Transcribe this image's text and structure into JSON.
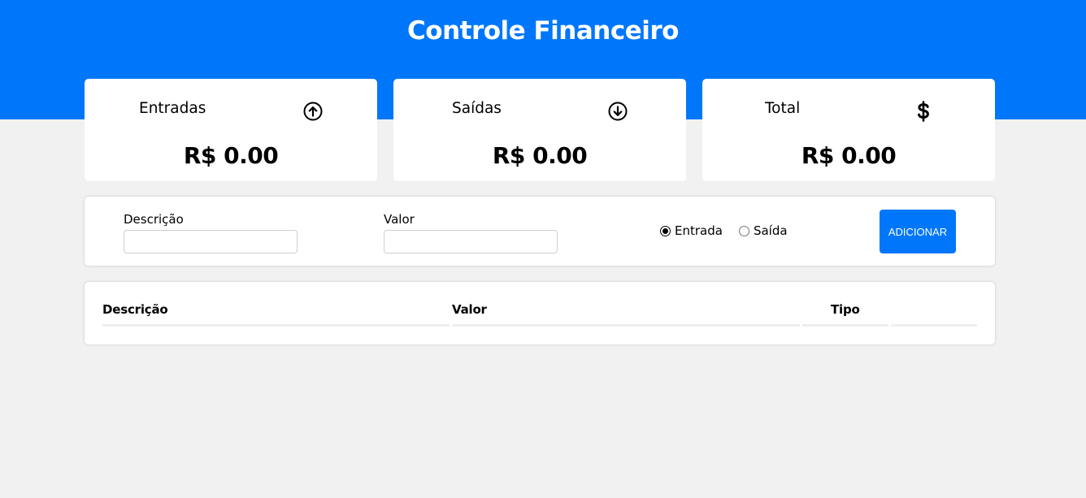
{
  "header": {
    "title": "Controle Financeiro",
    "background_color": "#0077fb"
  },
  "summary": {
    "income": {
      "label": "Entradas",
      "value": "R$ 0.00",
      "icon": "arrow-up-circle-icon"
    },
    "expense": {
      "label": "Saídas",
      "value": "R$ 0.00",
      "icon": "arrow-down-circle-icon"
    },
    "total": {
      "label": "Total",
      "value": "R$ 0.00",
      "icon": "dollar-icon"
    }
  },
  "form": {
    "description_label": "Descrição",
    "description_value": "",
    "value_label": "Valor",
    "value_value": "",
    "type_options": [
      {
        "label": "Entrada",
        "checked": true
      },
      {
        "label": "Saída",
        "checked": false
      }
    ],
    "add_button_label": "ADICIONAR"
  },
  "table": {
    "columns": [
      "Descrição",
      "Valor",
      "Tipo",
      ""
    ],
    "rows": []
  }
}
